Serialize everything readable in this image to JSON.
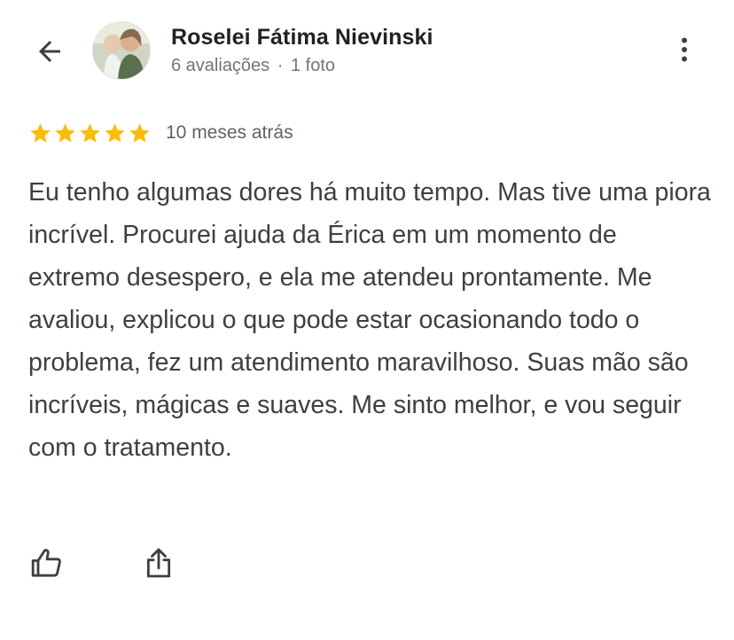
{
  "header": {
    "back_icon": "arrow-back-icon",
    "more_icon": "more-vertical-icon",
    "author_name": "Roselei Fátima Nievinski",
    "reviews_count": "6 avaliações",
    "separator": "·",
    "photos_count": "1 foto"
  },
  "review": {
    "rating": 5,
    "max_rating": 5,
    "star_color": "#fbbc04",
    "time_ago": "10 meses atrás",
    "text": "Eu tenho algumas dores há muito tempo. Mas tive uma piora incrível. Procurei ajuda da Érica em um momento de extremo desespero, e ela me atendeu prontamente. Me avaliou, explicou o que pode estar ocasionando todo o problema, fez um atendimento maravilhoso. Suas mão são incríveis, mágicas e suaves. Me sinto melhor, e vou seguir com o tratamento."
  },
  "actions": {
    "like_icon": "thumb-up-icon",
    "share_icon": "share-icon"
  },
  "colors": {
    "text_primary": "#202124",
    "text_body": "#3c4043",
    "text_secondary": "#70757a",
    "icon": "#3c4043"
  }
}
